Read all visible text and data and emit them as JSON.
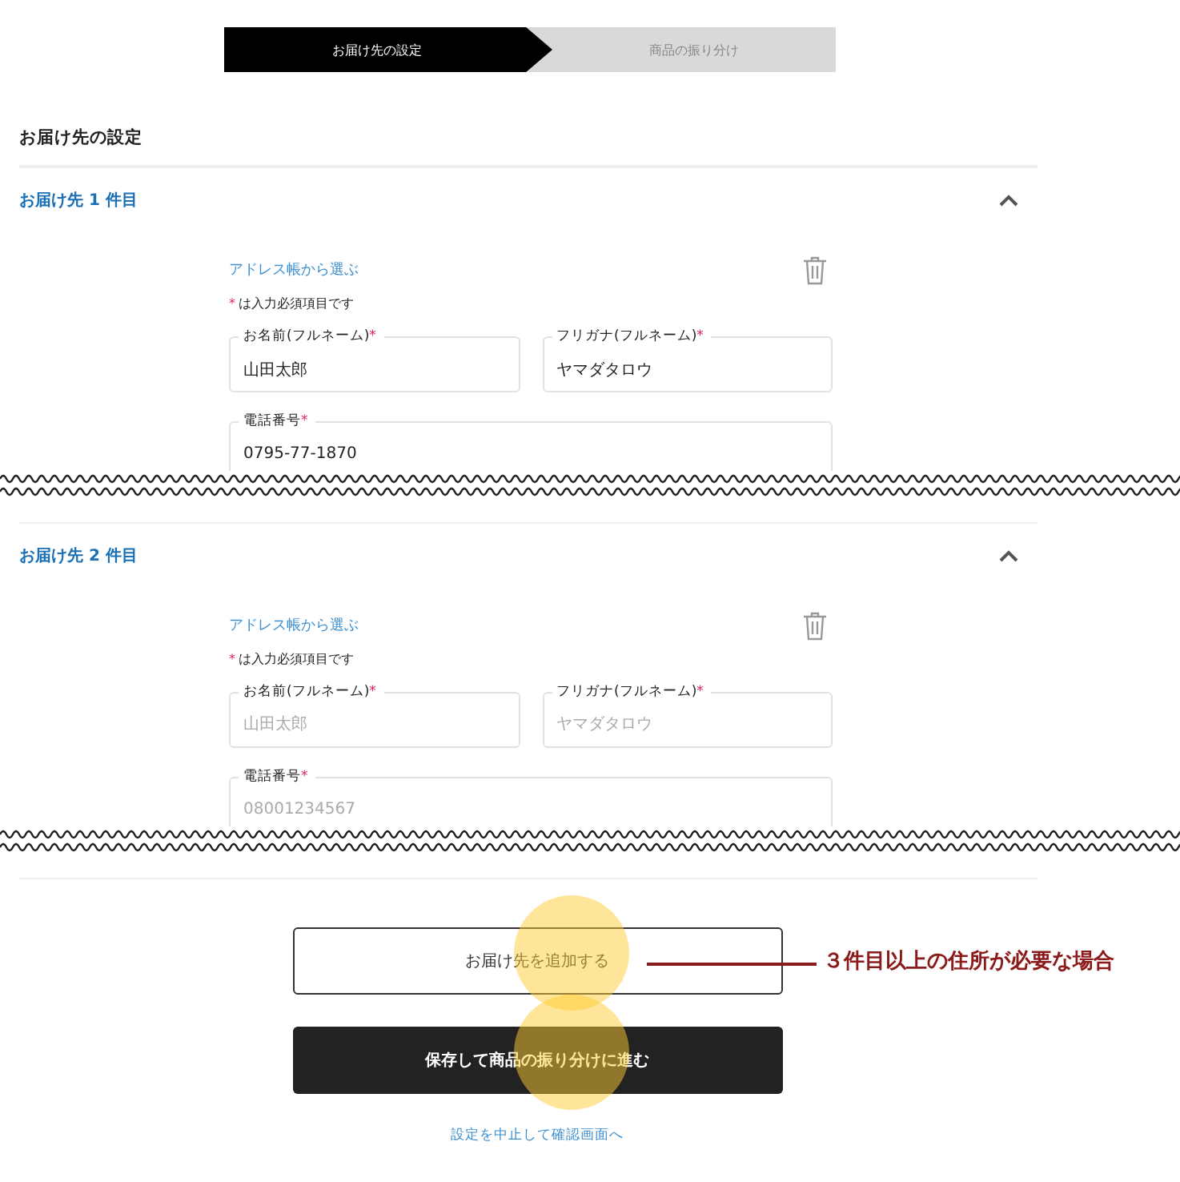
{
  "steps": [
    {
      "label": "お届け先の設定",
      "selected": true
    },
    {
      "label": "商品の振り分け",
      "selected": false
    }
  ],
  "heading": "お届け先の設定",
  "destinations": [
    {
      "title": "お届け先 1 件目",
      "expanded": true,
      "address_book_link": "アドレス帳から選ぶ",
      "required_mark": "*",
      "required_note": "は入力必須項目です",
      "fields": [
        {
          "label": "お名前(フルネーム)",
          "required": true,
          "value": "山田太郎"
        },
        {
          "label": "フリガナ(フルネーム)",
          "required": true,
          "value": "ヤマダタロウ"
        },
        {
          "label": "電話番号",
          "required": true,
          "value": "0795-77-1870"
        }
      ]
    },
    {
      "title": "お届け先 2 件目",
      "expanded": true,
      "address_book_link": "アドレス帳から選ぶ",
      "required_mark": "*",
      "required_note": "は入力必須項目です",
      "fields": [
        {
          "label": "お名前(フルネーム)",
          "required": true,
          "placeholder": "山田太郎"
        },
        {
          "label": "フリガナ(フルネーム)",
          "required": true,
          "placeholder": "ヤマダタロウ"
        },
        {
          "label": "電話番号",
          "required": true,
          "placeholder": "08001234567"
        }
      ]
    }
  ],
  "add_button": "お届け先を追加する",
  "annotation": "３件目以上の住所が必要な場合",
  "save_button": "保存して商品の振り分けに進む",
  "cancel_link": "設定を中止して確認画面へ"
}
